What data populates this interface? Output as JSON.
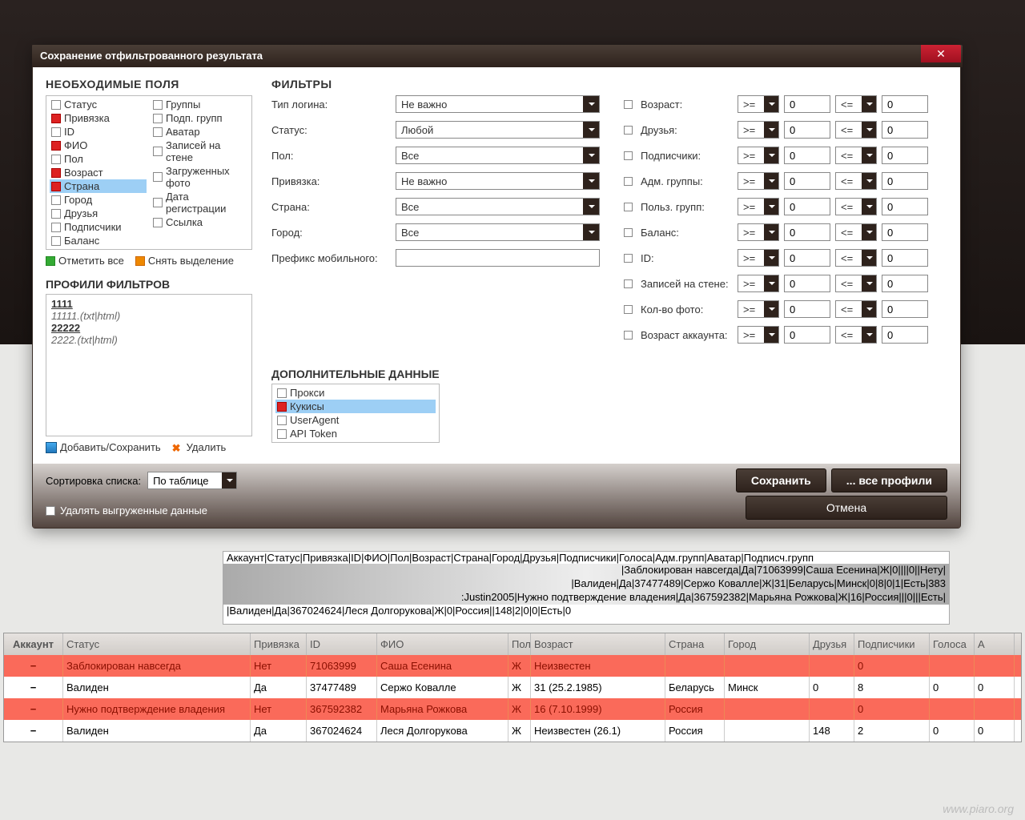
{
  "dialog": {
    "title": "Сохранение отфильтрованного результата",
    "close": "✕"
  },
  "fields": {
    "heading": "НЕОБХОДИМЫЕ ПОЛЯ",
    "left": [
      {
        "label": "Статус",
        "on": false
      },
      {
        "label": "Привязка",
        "on": true
      },
      {
        "label": "ID",
        "on": false
      },
      {
        "label": "ФИО",
        "on": true
      },
      {
        "label": "Пол",
        "on": false
      },
      {
        "label": "Возраст",
        "on": true
      },
      {
        "label": "Страна",
        "on": true,
        "hl": true
      },
      {
        "label": "Город",
        "on": false
      },
      {
        "label": "Друзья",
        "on": false
      },
      {
        "label": "Подписчики",
        "on": false
      },
      {
        "label": "Баланс",
        "on": false
      }
    ],
    "right": [
      {
        "label": "Группы",
        "on": false
      },
      {
        "label": "Подп. групп",
        "on": false
      },
      {
        "label": "Аватар",
        "on": false
      },
      {
        "label": "Записей на стене",
        "on": false
      },
      {
        "label": "Загруженных фото",
        "on": false
      },
      {
        "label": "Дата регистрации",
        "on": false
      },
      {
        "label": "Ссылка",
        "on": false
      }
    ],
    "select_all": "Отметить все",
    "deselect_all": "Снять выделение"
  },
  "profiles": {
    "heading": "ПРОФИЛИ ФИЛЬТРОВ",
    "items": [
      {
        "name": "1111",
        "ext": "11111.(txt|html)"
      },
      {
        "name": "22222",
        "ext": "2222.(txt|html)"
      }
    ],
    "add": "Добавить/Сохранить",
    "del": "Удалить"
  },
  "filters": {
    "heading": "ФИЛЬТРЫ",
    "rows": [
      {
        "label": "Тип логина:",
        "value": "Не важно"
      },
      {
        "label": "Статус:",
        "value": "Любой"
      },
      {
        "label": "Пол:",
        "value": "Все"
      },
      {
        "label": "Привязка:",
        "value": "Не важно"
      },
      {
        "label": "Страна:",
        "value": "Все"
      },
      {
        "label": "Город:",
        "value": "Все"
      }
    ],
    "prefix_label": "Префикс мобильного:",
    "prefix_value": ""
  },
  "ranges": [
    {
      "label": "Возраст:",
      "op1": ">=",
      "v1": "0",
      "op2": "<=",
      "v2": "0"
    },
    {
      "label": "Друзья:",
      "op1": ">=",
      "v1": "0",
      "op2": "<=",
      "v2": "0"
    },
    {
      "label": "Подписчики:",
      "op1": ">=",
      "v1": "0",
      "op2": "<=",
      "v2": "0"
    },
    {
      "label": "Адм. группы:",
      "op1": ">=",
      "v1": "0",
      "op2": "<=",
      "v2": "0"
    },
    {
      "label": "Польз. групп:",
      "op1": ">=",
      "v1": "0",
      "op2": "<=",
      "v2": "0"
    },
    {
      "label": "Баланс:",
      "op1": ">=",
      "v1": "0",
      "op2": "<=",
      "v2": "0"
    },
    {
      "label": "ID:",
      "op1": ">=",
      "v1": "0",
      "op2": "<=",
      "v2": "0"
    },
    {
      "label": "Записей на стене:",
      "op1": ">=",
      "v1": "0",
      "op2": "<=",
      "v2": "0"
    },
    {
      "label": "Кол-во фото:",
      "op1": ">=",
      "v1": "0",
      "op2": "<=",
      "v2": "0"
    },
    {
      "label": "Возраст аккаунта:",
      "op1": ">=",
      "v1": "0",
      "op2": "<=",
      "v2": "0"
    }
  ],
  "additional": {
    "heading": "ДОПОЛНИТЕЛЬНЫЕ ДАННЫЕ",
    "items": [
      {
        "label": "Прокси",
        "on": false
      },
      {
        "label": "Кукисы",
        "on": true,
        "hl": true
      },
      {
        "label": "UserAgent",
        "on": false
      },
      {
        "label": "API Token",
        "on": false
      }
    ]
  },
  "footer": {
    "sort_label": "Сортировка списка:",
    "sort_value": "По таблице",
    "delete_check": "Удалять выгруженные данные",
    "save": "Сохранить",
    "all_profiles": "... все профили",
    "cancel": "Отмена"
  },
  "log": [
    "Аккаунт|Статус|Привязка|ID|ФИО|Пол|Возраст|Страна|Город|Друзья|Подписчики|Голоса|Адм.групп|Аватар|Подписч.групп",
    "|Заблокирован навсегда|Да|71063999|Саша Есенина|Ж|0||||0||Нету|",
    "|Валиден|Да|37477489|Сержо Ковалле|Ж|31|Беларусь|Минск|0|8|0|1|Есть|383",
    ":Justin2005|Нужно подтверждение владения|Да|367592382|Марьяна Рожкова|Ж|16|Россия|||0|||Есть|",
    "|Валиден|Да|367024624|Леся Долгорукова|Ж|0|Россия||148|2|0|0|Есть|0"
  ],
  "table": {
    "headers": [
      "Аккаунт",
      "Статус",
      "Привязка",
      "ID",
      "ФИО",
      "Пол",
      "Возраст",
      "Страна",
      "Город",
      "Друзья",
      "Подписчики",
      "Голоса",
      "А"
    ],
    "rows": [
      {
        "red": true,
        "cells": [
          "−",
          "Заблокирован навсегда",
          "Нет",
          "71063999",
          "Саша Есенина",
          "Ж",
          "Неизвестен",
          "",
          "",
          "",
          "0",
          "",
          ""
        ]
      },
      {
        "red": false,
        "cells": [
          "−",
          "Валиден",
          "Да",
          "37477489",
          "Сержо Ковалле",
          "Ж",
          "31 (25.2.1985)",
          "Беларусь",
          "Минск",
          "0",
          "8",
          "0",
          "0"
        ]
      },
      {
        "red": true,
        "cells": [
          "−",
          "Нужно подтверждение владения",
          "Нет",
          "367592382",
          "Марьяна Рожкова",
          "Ж",
          "16 (7.10.1999)",
          "Россия",
          "",
          "",
          "0",
          "",
          ""
        ]
      },
      {
        "red": false,
        "cells": [
          "−",
          "Валиден",
          "Да",
          "367024624",
          "Леся Долгорукова",
          "Ж",
          "Неизвестен (26.1)",
          "Россия",
          "",
          "148",
          "2",
          "0",
          "0"
        ]
      }
    ]
  },
  "watermark": "www.piaro.org"
}
